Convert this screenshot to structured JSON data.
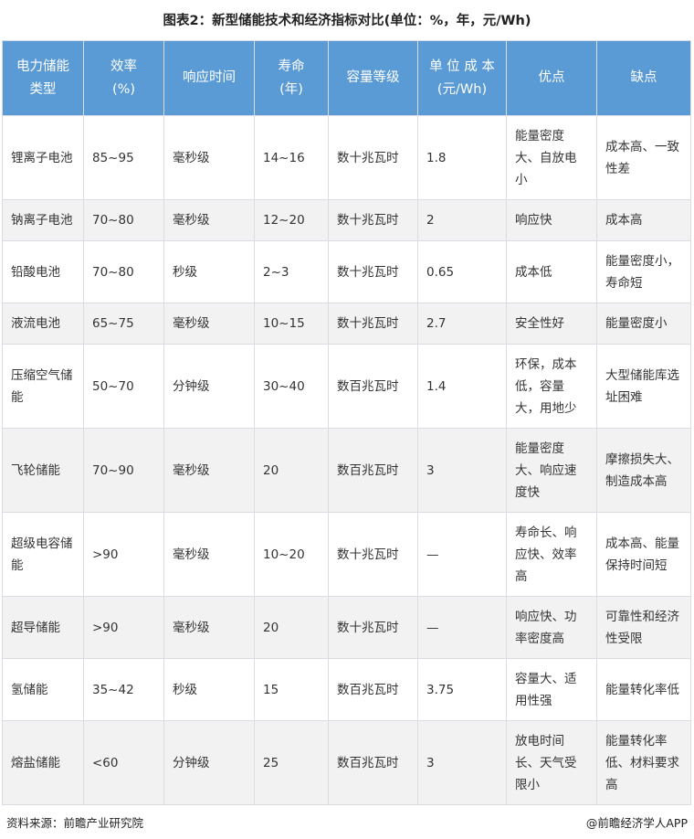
{
  "title": "图表2：新型储能技术和经济指标对比(单位：%，年，元/Wh)",
  "headers": [
    [
      "电力储能",
      "类型"
    ],
    [
      "效率",
      "(%)"
    ],
    [
      "响应时间"
    ],
    [
      "寿命",
      "(年)"
    ],
    [
      "容量等级"
    ],
    [
      "单 位 成 本",
      "(元/Wh)"
    ],
    [
      "优点"
    ],
    [
      "缺点"
    ]
  ],
  "rows": [
    {
      "cells": [
        "锂离子电池",
        "85~95",
        "毫秒级",
        "14~16",
        "数十兆瓦时",
        "1.8",
        "能量密度大、自放电小",
        "成本高、一致性差"
      ]
    },
    {
      "cells": [
        "钠离子电池",
        "70~80",
        "毫秒级",
        "12~20",
        "数十兆瓦时",
        "2",
        "响应快",
        "成本高"
      ]
    },
    {
      "cells": [
        "铅酸电池",
        "70~80",
        "秒级",
        "2~3",
        "数十兆瓦时",
        "0.65",
        "成本低",
        "能量密度小，寿命短"
      ]
    },
    {
      "cells": [
        "液流电池",
        "65~75",
        "毫秒级",
        "10~15",
        "数十兆瓦时",
        "2.7",
        "安全性好",
        "能量密度小"
      ]
    },
    {
      "cells": [
        "压缩空气储能",
        "50~70",
        "分钟级",
        "30~40",
        "数百兆瓦时",
        "1.4",
        "环保，成本低，容量大，用地少",
        "大型储能库选址困难"
      ]
    },
    {
      "cells": [
        "飞轮储能",
        "70~90",
        "毫秒级",
        "20",
        "数百兆瓦时",
        "3",
        "能量密度大、响应速度快",
        "摩擦损失大、制造成本高"
      ]
    },
    {
      "cells": [
        "超级电容储能",
        ">90",
        "毫秒级",
        "10~20",
        "数十兆瓦时",
        "—",
        "寿命长、响应快、效率高",
        "成本高、能量保持时间短"
      ]
    },
    {
      "cells": [
        "超导储能",
        ">90",
        "毫秒级",
        "20",
        "数十兆瓦时",
        "—",
        "响应快、功率密度高",
        "可靠性和经济性受限"
      ]
    },
    {
      "cells": [
        "氢储能",
        "35~42",
        "秒级",
        "15",
        "数百兆瓦时",
        "3.75",
        "容量大、适用性强",
        "能量转化率低"
      ]
    },
    {
      "cells": [
        "熔盐储能",
        "<60",
        "分钟级",
        "25",
        "数百兆瓦时",
        "3",
        "放电时间长、天气受限小",
        "能量转化率低、材料要求高"
      ]
    }
  ],
  "footer": {
    "source": "资料来源：前瞻产业研究院",
    "brand": "@前瞻经济学人APP"
  }
}
